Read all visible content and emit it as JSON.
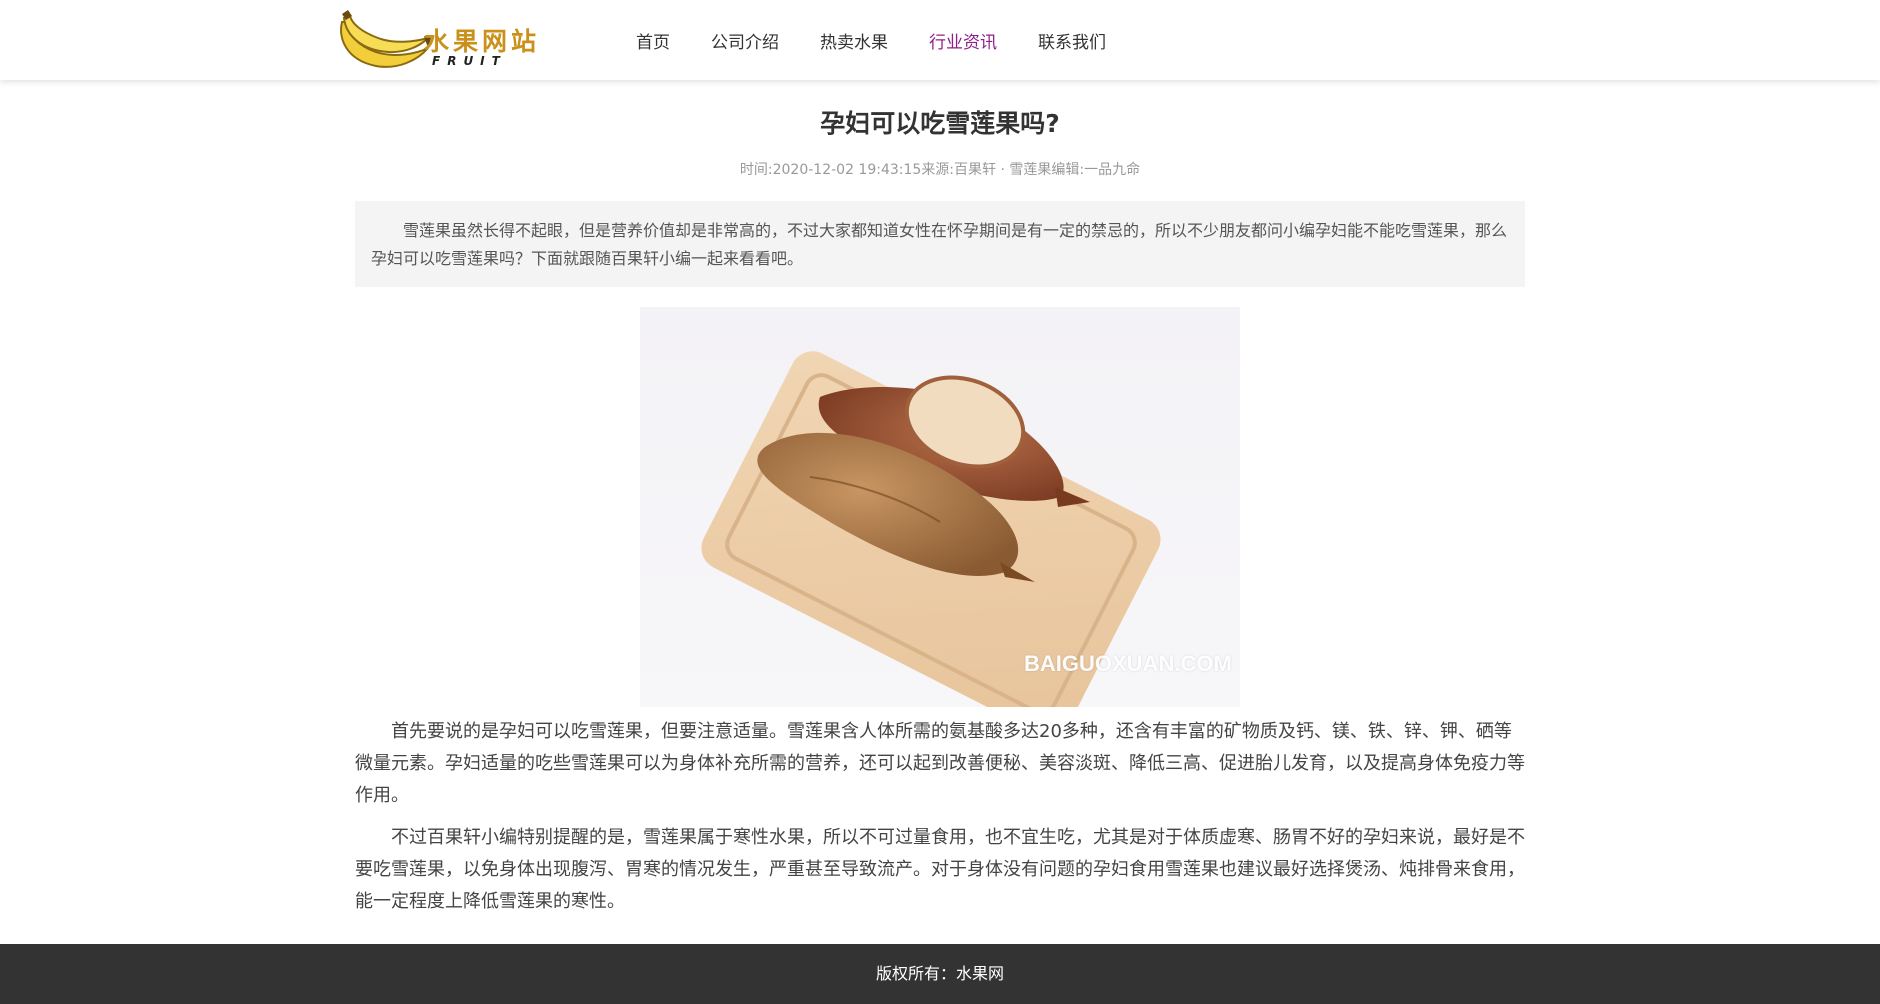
{
  "header": {
    "logo_title": "水果网站",
    "logo_sub": "FRUIT",
    "nav": [
      "首页",
      "公司介绍",
      "热卖水果",
      "行业资讯",
      "联系我们"
    ],
    "active_nav": "行业资讯",
    "active_color": "#8e1e8a"
  },
  "article": {
    "title": "孕妇可以吃雪莲果吗?",
    "meta": {
      "time_label": "时间:",
      "time": "2020-12-02 19:43:15",
      "source_label": "来源:",
      "source": "百果轩 · 雪莲果",
      "editor_label": "编辑:",
      "editor": "一品九命"
    },
    "summary": "雪莲果虽然长得不起眼，但是营养价值却是非常高的，不过大家都知道女性在怀孕期间是有一定的禁忌的，所以不少朋友都问小编孕妇能不能吃雪莲果，那么孕妇可以吃雪莲果吗？下面就跟随百果轩小编一起来看看吧。",
    "image_watermark": "BAIGUOXUAN.COM",
    "paragraphs": [
      "首先要说的是孕妇可以吃雪莲果，但要注意适量。雪莲果含人体所需的氨基酸多达20多种，还含有丰富的矿物质及钙、镁、铁、锌、钾、硒等微量元素。孕妇适量的吃些雪莲果可以为身体补充所需的营养，还可以起到改善便秘、美容淡斑、降低三高、促进胎儿发育，以及提高身体免疫力等作用。",
      "不过百果轩小编特别提醒的是，雪莲果属于寒性水果，所以不可过量食用，也不宜生吃，尤其是对于体质虚寒、肠胃不好的孕妇来说，最好是不要吃雪莲果，以免身体出现腹泻、胃寒的情况发生，严重甚至导致流产。对于身体没有问题的孕妇食用雪莲果也建议最好选择煲汤、炖排骨来食用，能一定程度上降低雪莲果的寒性。"
    ]
  },
  "footer": {
    "copyright": "版权所有：水果网"
  }
}
